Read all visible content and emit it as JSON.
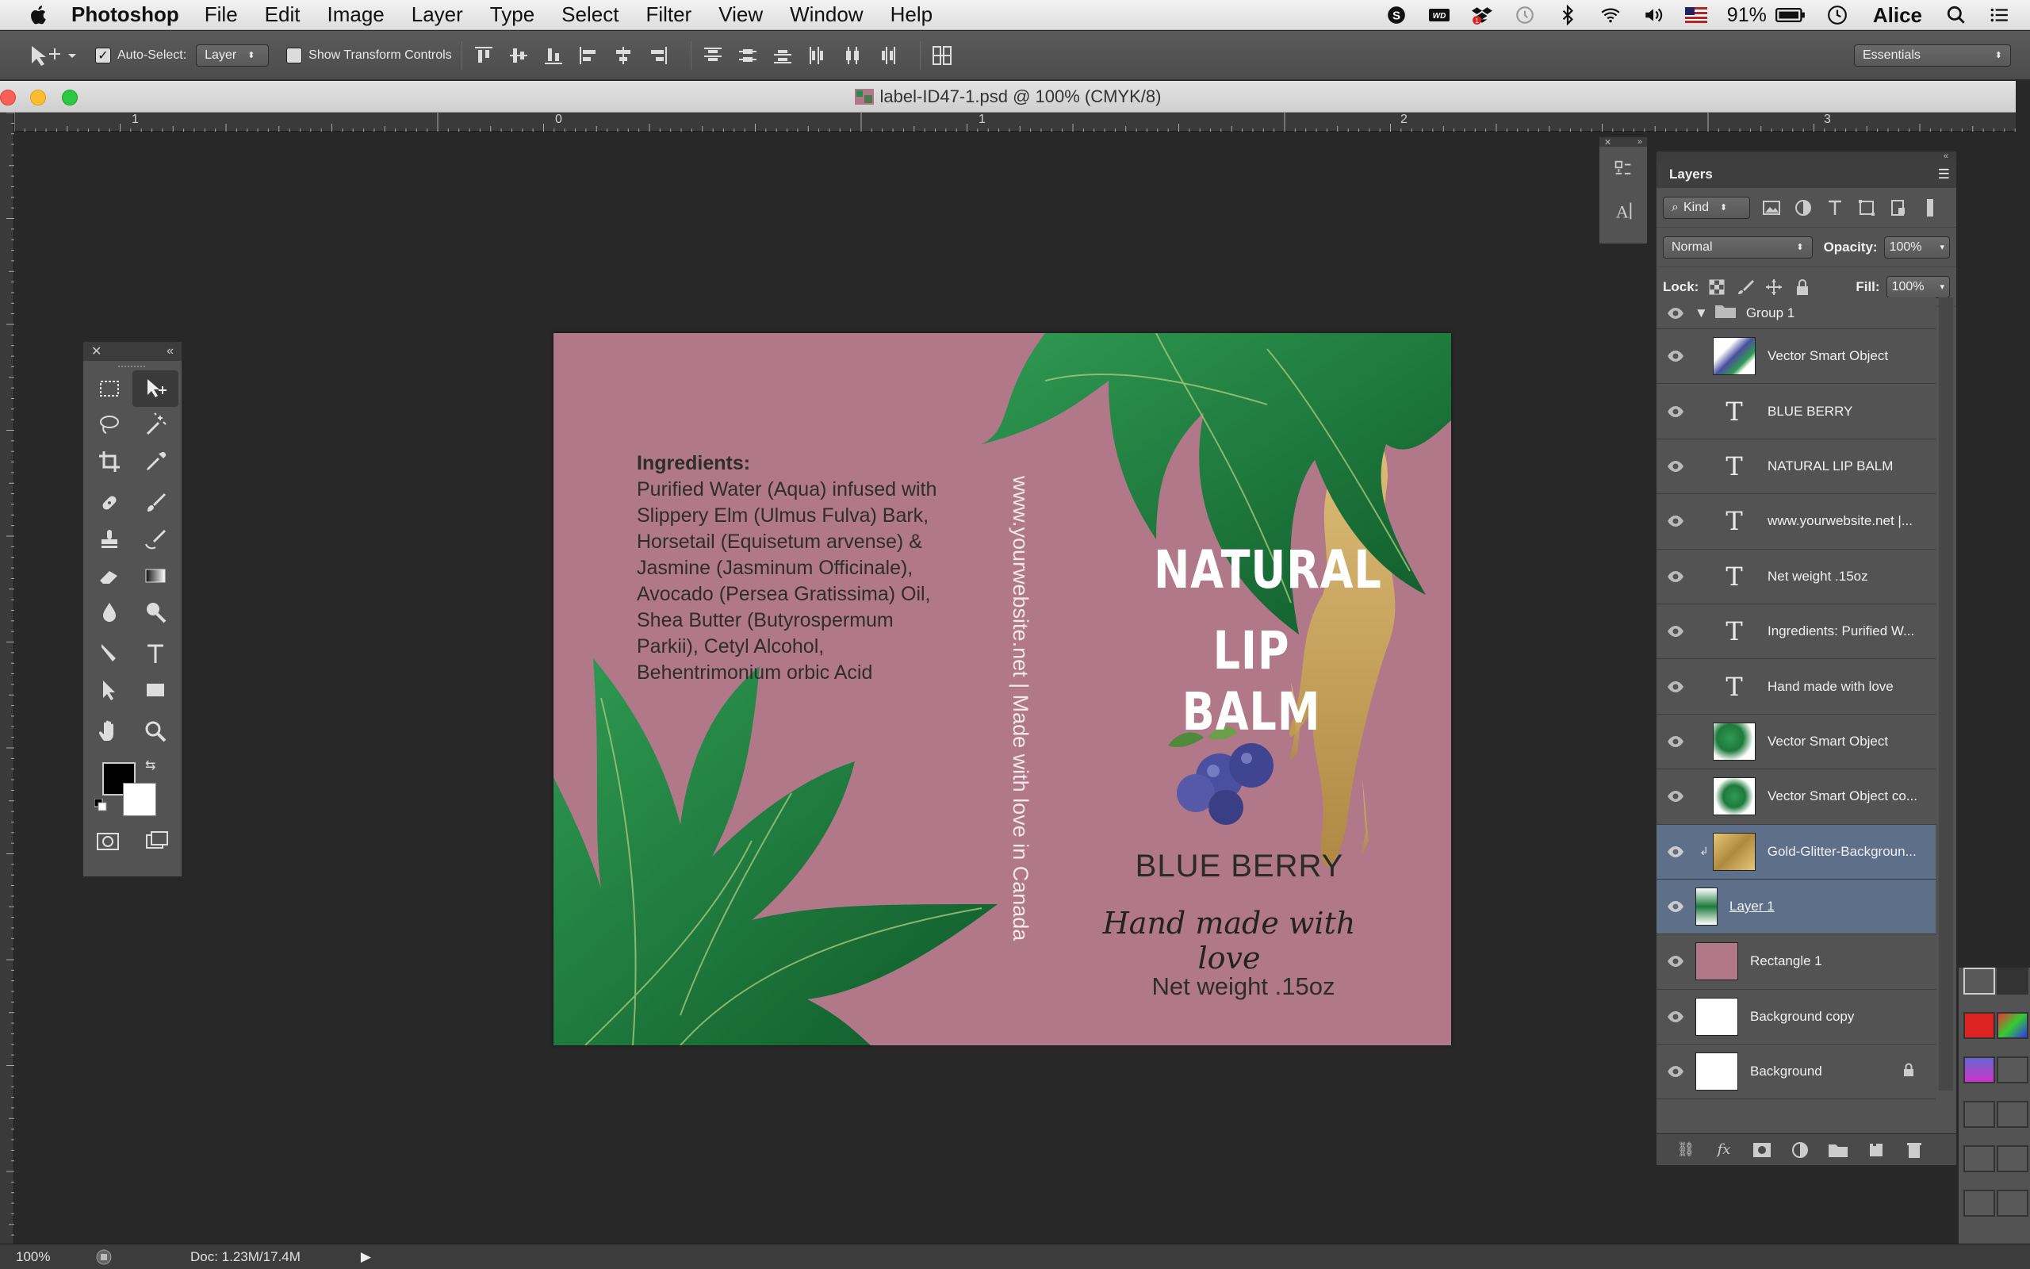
{
  "menubar": {
    "app_name": "Photoshop",
    "menus": [
      "File",
      "Edit",
      "Image",
      "Layer",
      "Type",
      "Select",
      "Filter",
      "View",
      "Window",
      "Help"
    ],
    "battery": "91%",
    "user": "Alice",
    "tray_icons": [
      "skype-icon",
      "wd-icon",
      "dropbox-icon",
      "time-machine-icon",
      "bluetooth-icon",
      "wifi-icon",
      "volume-icon",
      "flag-icon"
    ]
  },
  "options_bar": {
    "auto_select_label": "Auto-Select:",
    "auto_select_checked": true,
    "auto_select_target": "Layer",
    "show_transform_label": "Show Transform Controls",
    "workspace": "Essentials"
  },
  "document": {
    "title": "label-ID47-1.psd @ 100% (CMYK/8)",
    "ruler_numbers": [
      "1",
      "0",
      "1",
      "2",
      "3"
    ]
  },
  "label": {
    "ingredients_title": "Ingredients:",
    "ingredients_body": "Purified Water (Aqua) infused with Slippery Elm (Ulmus Fulva) Bark, Horsetail (Equisetum arvense) &  Jasmine (Jasminum Officinale), Avocado (Persea Gratissima) Oil, Shea Butter (Butyrospermum Parkii), Cetyl Alcohol, Behentrimonium orbic Acid",
    "vertical_text": "www.yourwebsite.net  |  Made with love in Canada",
    "title_line1": "NATURAL",
    "title_line2": "LIP BALM",
    "flavor": "BLUE BERRY",
    "tagline": "Hand made with love",
    "net_weight": "Net weight .15oz",
    "colors": {
      "background": "#b07888",
      "leaf": "#1e7a3c",
      "gold": "#c8a65a",
      "berry": "#4a4fa0"
    }
  },
  "layers_panel": {
    "tab": "Layers",
    "kind": "Kind",
    "blend_mode": "Normal",
    "opacity_label": "Opacity:",
    "opacity": "100%",
    "lock_label": "Lock:",
    "fill_label": "Fill:",
    "fill": "100%",
    "layers": [
      {
        "name": "Group 1",
        "type": "group"
      },
      {
        "name": "Vector Smart Object",
        "type": "smart"
      },
      {
        "name": "BLUE BERRY",
        "type": "text"
      },
      {
        "name": "NATURAL LIP BALM",
        "type": "text"
      },
      {
        "name": "www.yourwebsite.net  |...",
        "type": "text"
      },
      {
        "name": "Net weight .15oz",
        "type": "text"
      },
      {
        "name": "Ingredients:  Purified W...",
        "type": "text"
      },
      {
        "name": "Hand made with love",
        "type": "text"
      },
      {
        "name": "Vector Smart Object",
        "type": "smart"
      },
      {
        "name": "Vector Smart Object co...",
        "type": "smart"
      },
      {
        "name": "Gold-Glitter-Backgroun...",
        "type": "smart",
        "selected": true
      },
      {
        "name": "Layer 1",
        "type": "pixel",
        "selected": true
      },
      {
        "name": "Rectangle 1",
        "type": "shape"
      },
      {
        "name": "Background copy",
        "type": "pixel"
      },
      {
        "name": "Background",
        "type": "background",
        "locked": true
      }
    ]
  },
  "statusbar": {
    "zoom": "100%",
    "doc_info": "Doc: 1.23M/17.4M"
  }
}
